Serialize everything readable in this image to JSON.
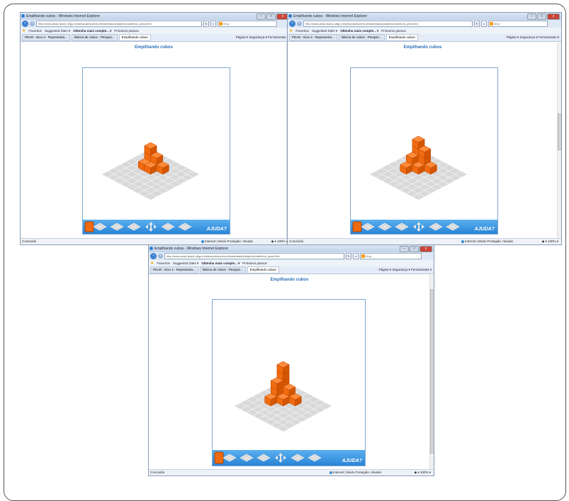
{
  "windows": [
    {
      "title": "Empilhando cubos - Windows Internet Explorer",
      "url": "http://www.pead.faced.ufrgs.br/sites/publico/eixo4/matematica/objetos/cubinhos_pead.htm",
      "search_engine": "Bing",
      "favorites": [
        "Favoritos",
        "Suggested Sites ▾",
        "Obtenha mais comple... ▾",
        "Primeiros passos"
      ],
      "tabs": [
        "PEAD - Eixo 4 - Representa...",
        "fabrica de cubos - Pesquis...",
        "Empilhando cubos"
      ],
      "commands": "Página ▾  Segurança ▾  Ferramentas ▾",
      "game_title": "Empilhando cubos",
      "help_label": "AJUDA?",
      "status_left": "Concluído",
      "status_zone": "Internet | Modo Protegido: Ativado",
      "status_zoom": "100%"
    },
    {
      "title": "Empilhando cubos - Windows Internet Explorer",
      "url": "http://www.pead.faced.ufrgs.br/sites/publico/eixo4/matematica/objetos/cubinhos_pead.htm",
      "search_engine": "Bing",
      "favorites": [
        "Favoritos",
        "Suggested Sites ▾",
        "Obtenha mais comple... ▾",
        "Primeiros passos"
      ],
      "tabs": [
        "PEAD - Eixo 4 - Representa...",
        "fabrica de cubos - Pesquis...",
        "Empilhando cubos"
      ],
      "commands": "Página ▾  Segurança ▾  Ferramentas ▾",
      "game_title": "Empilhando cubos",
      "help_label": "AJUDA?",
      "status_left": "Concluído",
      "status_zone": "Internet | Modo Protegido: Ativado",
      "status_zoom": "100%"
    },
    {
      "title": "Empilhando cubos - Windows Internet Explorer",
      "url": "http://www.pead.faced.ufrgs.br/sites/publico/eixo4/matematica/objetos/cubinhos_pead.htm",
      "search_engine": "Bing",
      "favorites": [
        "Favoritos",
        "Suggested Sites ▾",
        "Obtenha mais comple... ▾",
        "Primeiros passos"
      ],
      "tabs": [
        "PEAD - Eixo 4 - Representa...",
        "fabrica de cubos - Pesquis...",
        "Empilhando cubos"
      ],
      "commands": "Página ▾  Segurança ▾  Ferramentas ▾",
      "game_title": "Empilhando cubos",
      "help_label": "AJUDA?",
      "status_left": "Concluído",
      "status_zone": "Internet | Modo Protegido: Ativado",
      "status_zoom": "100%"
    }
  ],
  "colors": {
    "cube": "#f06a0f",
    "toolbar": "#3b97e3",
    "grid": "#d9d9d9"
  }
}
